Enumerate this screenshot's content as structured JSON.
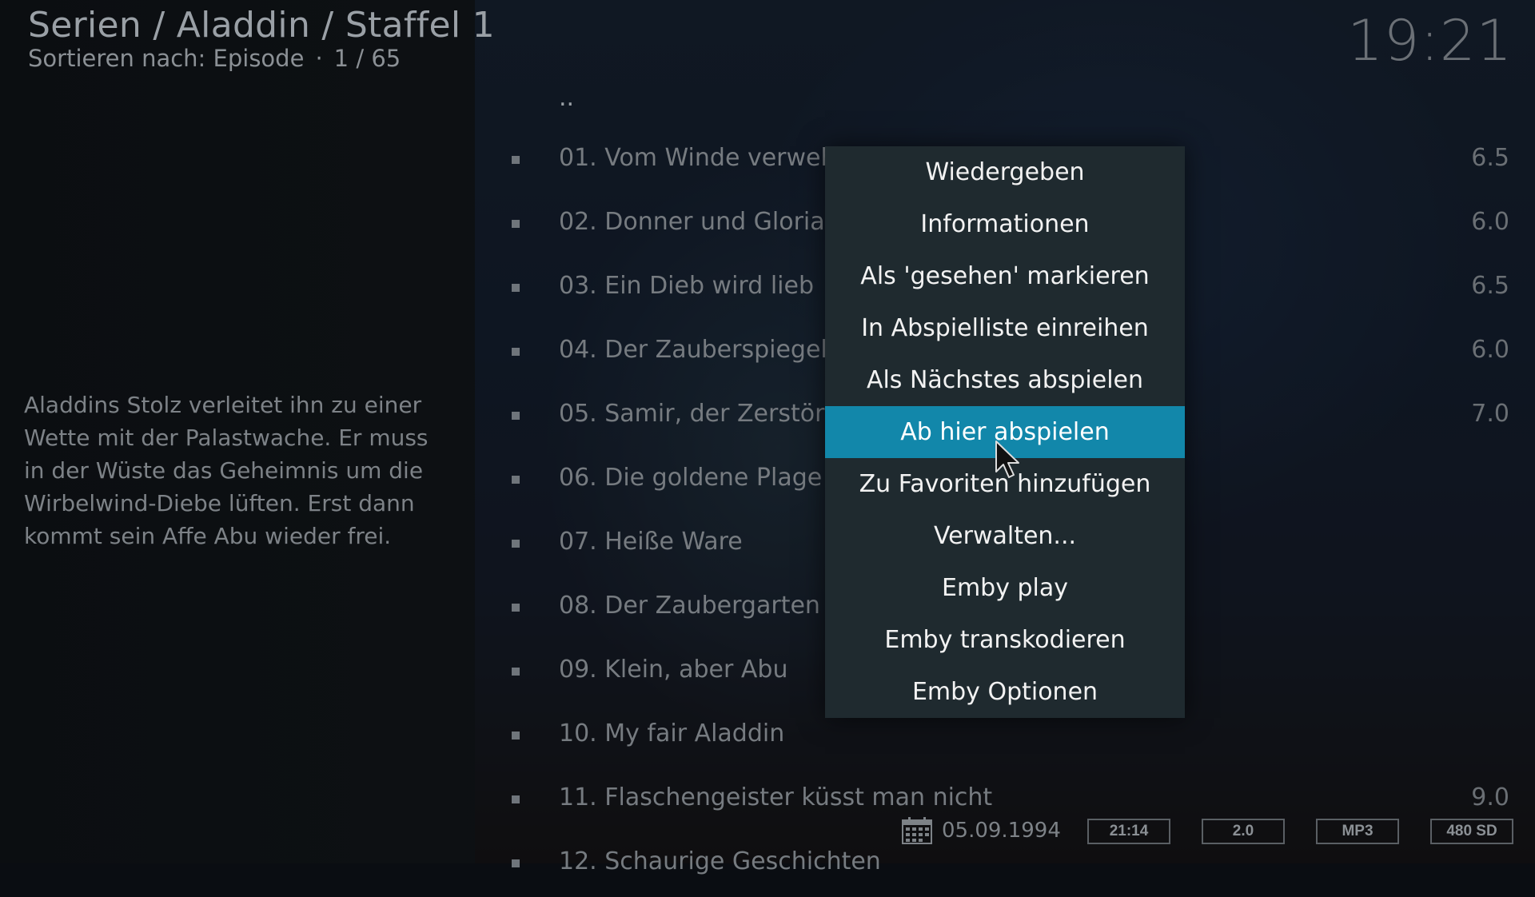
{
  "header": {
    "breadcrumb": "Serien / Aladdin / Staffel 1",
    "sort_label": "Sortieren nach: Episode",
    "separator": "·",
    "position": "1 / 65",
    "clock": "19:21"
  },
  "plot": "Aladdins Stolz verleitet ihn zu einer Wette mit der Palastwache. Er muss in der Wüste das Geheimnis um die Wirbelwind-Diebe lüften. Erst dann kommt sein Affe Abu wieder frei.",
  "list": {
    "parent_item": "..",
    "episodes": [
      {
        "title": "01. Vom Winde verweht",
        "rating": "6.5"
      },
      {
        "title": "02. Donner und Gloria",
        "rating": "6.0"
      },
      {
        "title": "03. Ein Dieb wird lieb",
        "rating": "6.5"
      },
      {
        "title": "04. Der Zauberspiegel",
        "rating": "6.0"
      },
      {
        "title": "05. Samir, der Zerstörer",
        "rating": "7.0"
      },
      {
        "title": "06. Die goldene Plage",
        "rating": ""
      },
      {
        "title": "07. Heiße Ware",
        "rating": ""
      },
      {
        "title": "08. Der Zaubergarten",
        "rating": ""
      },
      {
        "title": "09. Klein, aber Abu",
        "rating": ""
      },
      {
        "title": "10. My fair Aladdin",
        "rating": ""
      },
      {
        "title": "11. Flaschengeister küsst man nicht",
        "rating": "9.0"
      },
      {
        "title": "12. Schaurige Geschichten",
        "rating": ""
      }
    ]
  },
  "context_menu": {
    "items": [
      {
        "label": "Wiedergeben"
      },
      {
        "label": "Informationen"
      },
      {
        "label": "Als 'gesehen' markieren"
      },
      {
        "label": "In Abspielliste einreihen"
      },
      {
        "label": "Als Nächstes abspielen"
      },
      {
        "label": "Ab hier abspielen",
        "active": true
      },
      {
        "label": "Zu Favoriten hinzufügen"
      },
      {
        "label": "Verwalten..."
      },
      {
        "label": "Emby play"
      },
      {
        "label": "Emby transkodieren"
      },
      {
        "label": "Emby Optionen"
      }
    ]
  },
  "infobar": {
    "calendar_icon": "calendar-icon",
    "date": "05.09.1994",
    "flags": [
      "21:14",
      "2.0",
      "MP3",
      "480 SD"
    ]
  },
  "colors": {
    "accent": "#1287aa",
    "menu_bg": "#1f2a2f"
  }
}
